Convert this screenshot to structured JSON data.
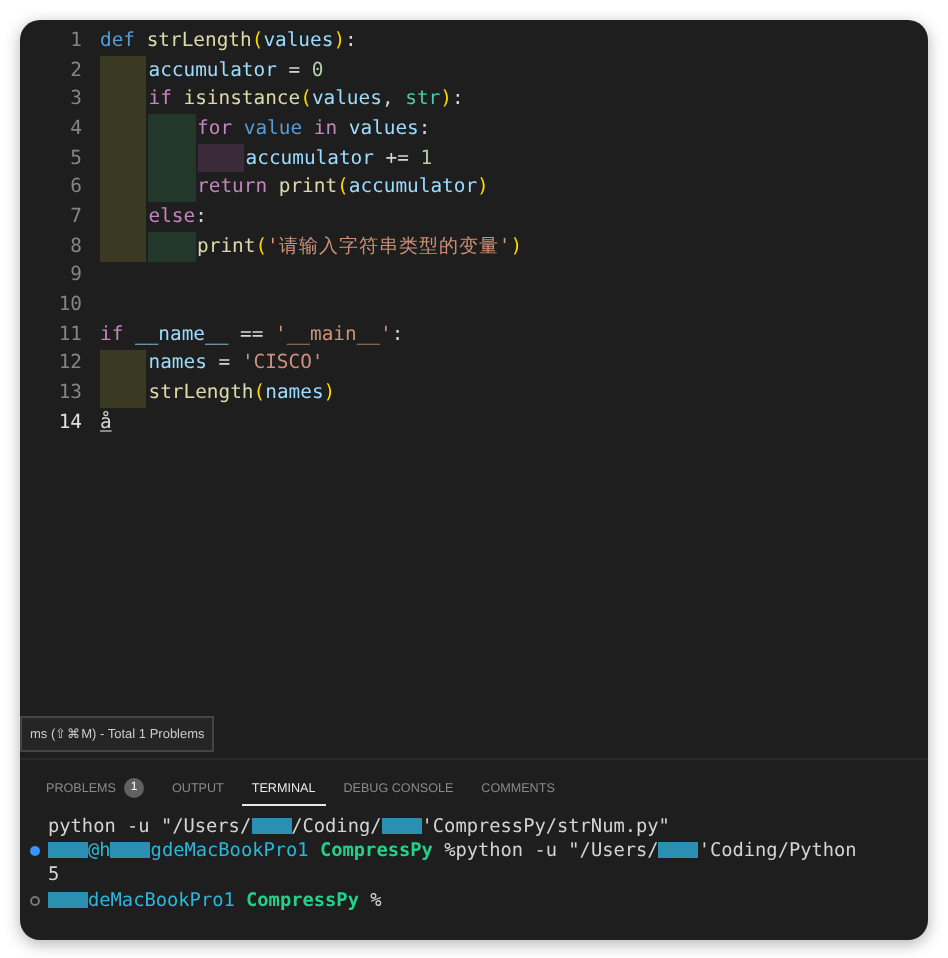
{
  "editor": {
    "lines": [
      {
        "number": "1",
        "current": false,
        "tokens": [
          {
            "kind": "kw",
            "text": "def "
          },
          {
            "kind": "fn",
            "text": "strLength"
          },
          {
            "kind": "paren",
            "text": "("
          },
          {
            "kind": "var",
            "text": "values"
          },
          {
            "kind": "paren",
            "text": ")"
          },
          {
            "kind": "plain",
            "text": ":"
          }
        ],
        "children": [
          {
            "number": "2",
            "current": false,
            "tokens": [
              {
                "kind": "var",
                "text": "accumulator"
              },
              {
                "kind": "plain",
                "text": " = "
              },
              {
                "kind": "num",
                "text": "0"
              }
            ]
          },
          {
            "number": "3",
            "current": false,
            "tokens": [
              {
                "kind": "ctl",
                "text": "if "
              },
              {
                "kind": "fn",
                "text": "isinstance"
              },
              {
                "kind": "paren",
                "text": "("
              },
              {
                "kind": "var",
                "text": "values"
              },
              {
                "kind": "plain",
                "text": ", "
              },
              {
                "kind": "type",
                "text": "str"
              },
              {
                "kind": "paren",
                "text": ")"
              },
              {
                "kind": "plain",
                "text": ":"
              }
            ],
            "children": [
              {
                "number": "4",
                "current": false,
                "tokens": [
                  {
                    "kind": "ctl",
                    "text": "for "
                  },
                  {
                    "kind": "kw",
                    "text": "value "
                  },
                  {
                    "kind": "ctl",
                    "text": "in "
                  },
                  {
                    "kind": "var",
                    "text": "values"
                  },
                  {
                    "kind": "plain",
                    "text": ":"
                  }
                ],
                "children": [
                  {
                    "number": "5",
                    "current": false,
                    "tokens": [
                      {
                        "kind": "var",
                        "text": "accumulator"
                      },
                      {
                        "kind": "plain",
                        "text": " += "
                      },
                      {
                        "kind": "num",
                        "text": "1"
                      }
                    ]
                  }
                ]
              },
              {
                "number": "6",
                "current": false,
                "tokens": [
                  {
                    "kind": "ctl",
                    "text": "return "
                  },
                  {
                    "kind": "fn",
                    "text": "print"
                  },
                  {
                    "kind": "paren",
                    "text": "("
                  },
                  {
                    "kind": "var",
                    "text": "accumulator"
                  },
                  {
                    "kind": "paren",
                    "text": ")"
                  }
                ]
              }
            ]
          },
          {
            "number": "7",
            "current": false,
            "tokens": [
              {
                "kind": "ctl",
                "text": "else"
              },
              {
                "kind": "plain",
                "text": ":"
              }
            ],
            "children": [
              {
                "number": "8",
                "current": false,
                "tokens": [
                  {
                    "kind": "fn",
                    "text": "print"
                  },
                  {
                    "kind": "paren",
                    "text": "("
                  },
                  {
                    "kind": "str",
                    "text": "'请输入字符串类型的变量'"
                  },
                  {
                    "kind": "paren",
                    "text": ")"
                  }
                ]
              }
            ]
          }
        ]
      },
      {
        "number": "9",
        "current": false
      },
      {
        "number": "10",
        "current": false
      },
      {
        "number": "11",
        "current": false,
        "tokens": [
          {
            "kind": "ctl",
            "text": "if "
          },
          {
            "kind": "var",
            "text": "__name__"
          },
          {
            "kind": "plain",
            "text": " == "
          },
          {
            "kind": "str",
            "text": "'__main__'"
          },
          {
            "kind": "plain",
            "text": ":"
          }
        ],
        "children": [
          {
            "number": "12",
            "current": false,
            "tokens": [
              {
                "kind": "var",
                "text": "names"
              },
              {
                "kind": "plain",
                "text": " = "
              },
              {
                "kind": "str",
                "text": "'CISCO'"
              }
            ]
          },
          {
            "number": "13",
            "current": false,
            "tokens": [
              {
                "kind": "fn",
                "text": "strLength"
              },
              {
                "kind": "paren",
                "text": "("
              },
              {
                "kind": "var",
                "text": "names"
              },
              {
                "kind": "paren",
                "text": ")"
              }
            ]
          }
        ]
      },
      {
        "number": "14",
        "current": true,
        "tokens": [
          {
            "kind": "plain",
            "text": "å"
          }
        ]
      }
    ]
  },
  "tooltip": "ms (⇧⌘M) - Total 1 Problems",
  "panel": {
    "tabs": [
      {
        "label": "PROBLEMS",
        "badge": "1",
        "selected": false
      },
      {
        "label": "OUTPUT",
        "selected": false
      },
      {
        "label": "TERMINAL",
        "selected": true
      },
      {
        "label": "DEBUG CONSOLE",
        "selected": false
      },
      {
        "label": "COMMENTS",
        "selected": false
      }
    ],
    "terminal": [
      {
        "kind": "output",
        "segments": [
          {
            "kind": "text",
            "text": "python -u \"/Users/"
          },
          {
            "kind": "redacted"
          },
          {
            "kind": "text",
            "text": "/Coding/"
          },
          {
            "kind": "redacted"
          },
          {
            "kind": "text",
            "text": "'CompressPy/strNum.py\""
          }
        ]
      },
      {
        "kind": "finished_prompt",
        "segments": [
          {
            "kind": "redacted"
          },
          {
            "kind": "user",
            "text": "@h"
          },
          {
            "kind": "redacted"
          },
          {
            "kind": "user",
            "text": "gdeMacBookPro1"
          },
          {
            "kind": "dir",
            "text": " CompressPy"
          },
          {
            "kind": "text",
            "text": " %python -u \"/Users/"
          },
          {
            "kind": "redacted"
          },
          {
            "kind": "text",
            "text": "'Coding/Python"
          }
        ]
      },
      {
        "kind": "output",
        "segments": [
          {
            "kind": "text",
            "text": "5"
          }
        ]
      },
      {
        "kind": "current_prompt",
        "segments": [
          {
            "kind": "redacted"
          },
          {
            "kind": "user",
            "text": "deMacBookPro1"
          },
          {
            "kind": "dir",
            "text": " CompressPy"
          },
          {
            "kind": "text",
            "text": " %"
          }
        ]
      }
    ]
  }
}
